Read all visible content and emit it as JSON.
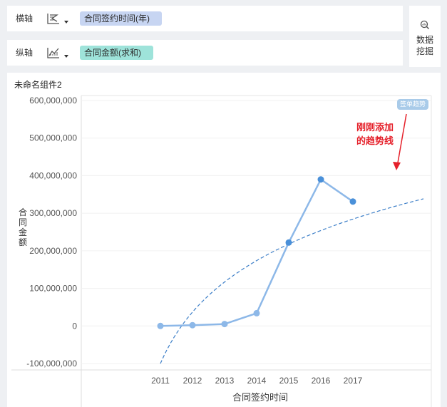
{
  "x_shelf": {
    "label": "横轴",
    "field": "合同签约时间(年)",
    "icon": "dimension-chart-icon",
    "color": "#c7d5f2"
  },
  "y_shelf": {
    "label": "纵轴",
    "field": "合同金额(求和)",
    "icon": "line-chart-icon",
    "color": "#9ee3da"
  },
  "data_mining": {
    "label": "数据\n挖掘",
    "icon": "magnifier-chart-icon"
  },
  "widget": {
    "title": "未命名组件2"
  },
  "badge": "签单趋势",
  "annotation": "刚刚添加\n的趋势线",
  "chart_data": {
    "type": "line",
    "title": "",
    "xlabel": "合同签约时间",
    "ylabel": "合同金额",
    "categories": [
      "2011",
      "2012",
      "2013",
      "2014",
      "2015",
      "2016",
      "2017"
    ],
    "ylim": [
      -100000000,
      600000000
    ],
    "yticks": [
      "-100,000,000",
      "0",
      "100,000,000",
      "200,000,000",
      "300,000,000",
      "400,000,000",
      "500,000,000",
      "600,000,000"
    ],
    "series": [
      {
        "values": [
          0,
          2000000,
          5000000,
          34000000,
          222000000,
          390000000,
          331000000
        ],
        "color": "#8db8e8"
      }
    ],
    "trendline": {
      "style": "dashed",
      "color": "#3d7fc8"
    },
    "grid": "horizontal",
    "annotation_color": "#e5202a"
  }
}
